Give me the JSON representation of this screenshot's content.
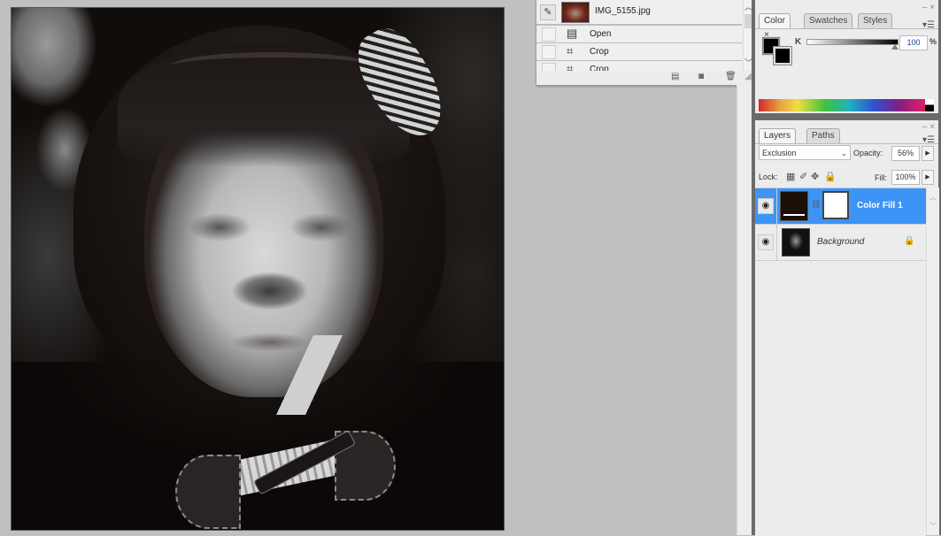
{
  "canvas": {
    "document_name": "IMG_5155.jpg"
  },
  "history": {
    "snapshot": {
      "name": "IMG_5155.jpg",
      "icon": "history-brush-icon"
    },
    "steps": [
      {
        "label": "Open",
        "icon": "open-document-icon"
      },
      {
        "label": "Crop",
        "icon": "crop-icon"
      },
      {
        "label": "Crop",
        "icon": "crop-icon"
      }
    ],
    "footer_icons": [
      "new-document-from-state-icon",
      "new-snapshot-icon",
      "delete-icon"
    ]
  },
  "color_panel": {
    "tabs": [
      {
        "label": "Color",
        "active": true,
        "closable": true
      },
      {
        "label": "Swatches",
        "active": false
      },
      {
        "label": "Styles",
        "active": false
      }
    ],
    "foreground": "#000000",
    "background": "#000000",
    "channel_label": "K",
    "channel_value": "100",
    "percent_sign": "%",
    "window_controls": {
      "minimize": "–",
      "close": "×"
    }
  },
  "layers_panel": {
    "tabs": [
      {
        "label": "Layers",
        "active": true,
        "closable": true
      },
      {
        "label": "Paths",
        "active": false
      }
    ],
    "blend_mode": "Exclusion",
    "opacity_label": "Opacity:",
    "opacity_value": "56%",
    "lock_label": "Lock:",
    "fill_label": "Fill:",
    "fill_value": "100%",
    "window_controls": {
      "minimize": "–",
      "close": "×"
    },
    "layers": [
      {
        "name": "Color Fill 1",
        "selected": true,
        "visible": true,
        "fill_color": "#1a1008",
        "has_mask": true
      },
      {
        "name": "Background",
        "selected": false,
        "visible": true,
        "locked": true
      }
    ],
    "selection_color": "#3d94f6"
  }
}
